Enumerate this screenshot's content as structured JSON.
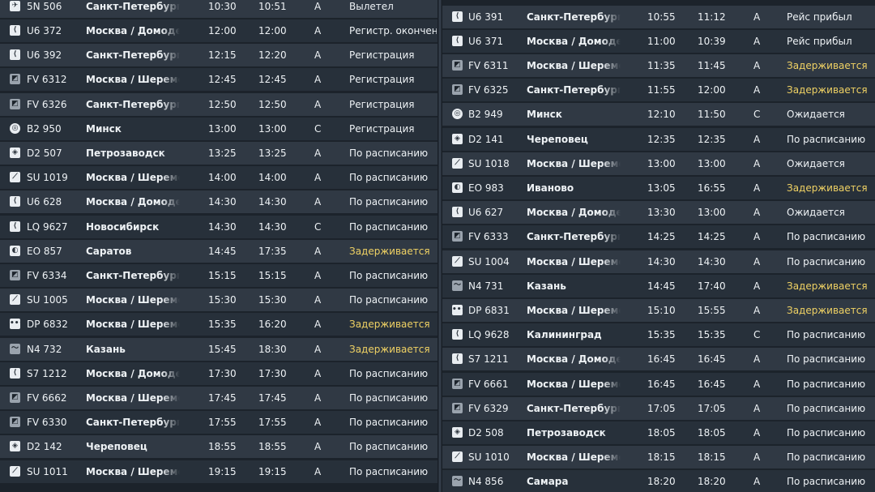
{
  "colors": {
    "background": "#1c232b",
    "row_light": "#303944",
    "row_dark": "#27303a",
    "text": "#eef2f5",
    "delayed": "#f0d264"
  },
  "left_flights": [
    {
      "logo": "plane-icon",
      "flight": "5N 506",
      "destination": "Санкт-Петербург",
      "scheduled": "10:30",
      "estimated": "10:51",
      "terminal": "A",
      "status": "Вылетел",
      "delayed": false
    },
    {
      "logo": "s7-logo-icon",
      "flight": "U6 372",
      "destination": "Москва / Домодедово",
      "scheduled": "12:00",
      "estimated": "12:00",
      "terminal": "A",
      "status": "Регистр. окончена",
      "delayed": false
    },
    {
      "logo": "s7-logo-icon",
      "flight": "U6 392",
      "destination": "Санкт-Петербург",
      "scheduled": "12:15",
      "estimated": "12:20",
      "terminal": "A",
      "status": "Регистрация",
      "delayed": false
    },
    {
      "logo": "rossiya-logo-icon",
      "flight": "FV 6312",
      "destination": "Москва / Шереметьево",
      "scheduled": "12:45",
      "estimated": "12:45",
      "terminal": "A",
      "status": "Регистрация",
      "delayed": false
    },
    {
      "logo": "rossiya-logo-icon",
      "flight": "FV 6326",
      "destination": "Санкт-Петербург",
      "scheduled": "12:50",
      "estimated": "12:50",
      "terminal": "A",
      "status": "Регистрация",
      "delayed": false
    },
    {
      "logo": "belavia-logo-icon",
      "flight": "B2 950",
      "destination": "Минск",
      "scheduled": "13:00",
      "estimated": "13:00",
      "terminal": "C",
      "status": "Регистрация",
      "delayed": false
    },
    {
      "logo": "severstal-logo-icon",
      "flight": "D2 507",
      "destination": "Петрозаводск",
      "scheduled": "13:25",
      "estimated": "13:25",
      "terminal": "A",
      "status": "По расписанию",
      "delayed": false
    },
    {
      "logo": "aeroflot-logo-icon",
      "flight": "SU 1019",
      "destination": "Москва / Шереметьево",
      "scheduled": "14:00",
      "estimated": "14:00",
      "terminal": "A",
      "status": "По расписанию",
      "delayed": false
    },
    {
      "logo": "s7-logo-icon",
      "flight": "U6 628",
      "destination": "Москва / Домодедово",
      "scheduled": "14:30",
      "estimated": "14:30",
      "terminal": "A",
      "status": "По расписанию",
      "delayed": false
    },
    {
      "logo": "s7-logo-icon",
      "flight": "LQ 9627",
      "destination": "Новосибирск",
      "scheduled": "14:30",
      "estimated": "14:30",
      "terminal": "C",
      "status": "По расписанию",
      "delayed": false
    },
    {
      "logo": "utair-logo-icon",
      "flight": "EO 857",
      "destination": "Саратов",
      "scheduled": "14:45",
      "estimated": "17:35",
      "terminal": "A",
      "status": "Задерживается",
      "delayed": true
    },
    {
      "logo": "rossiya-logo-icon",
      "flight": "FV 6334",
      "destination": "Санкт-Петербург",
      "scheduled": "15:15",
      "estimated": "15:15",
      "terminal": "A",
      "status": "По расписанию",
      "delayed": false
    },
    {
      "logo": "aeroflot-logo-icon",
      "flight": "SU 1005",
      "destination": "Москва / Шереметьево",
      "scheduled": "15:30",
      "estimated": "15:30",
      "terminal": "A",
      "status": "По расписанию",
      "delayed": false
    },
    {
      "logo": "pobeda-logo-icon",
      "flight": "DP 6832",
      "destination": "Москва / Шереметьево",
      "scheduled": "15:35",
      "estimated": "16:20",
      "terminal": "A",
      "status": "Задерживается",
      "delayed": true
    },
    {
      "logo": "nordwind-logo-icon",
      "flight": "N4 732",
      "destination": "Казань",
      "scheduled": "15:45",
      "estimated": "18:30",
      "terminal": "A",
      "status": "Задерживается",
      "delayed": true
    },
    {
      "logo": "s7-logo-icon",
      "flight": "S7 1212",
      "destination": "Москва / Домодедово",
      "scheduled": "17:30",
      "estimated": "17:30",
      "terminal": "A",
      "status": "По расписанию",
      "delayed": false
    },
    {
      "logo": "rossiya-logo-icon",
      "flight": "FV 6662",
      "destination": "Москва / Шереметьево",
      "scheduled": "17:45",
      "estimated": "17:45",
      "terminal": "A",
      "status": "По расписанию",
      "delayed": false
    },
    {
      "logo": "rossiya-logo-icon",
      "flight": "FV 6330",
      "destination": "Санкт-Петербург",
      "scheduled": "17:55",
      "estimated": "17:55",
      "terminal": "A",
      "status": "По расписанию",
      "delayed": false
    },
    {
      "logo": "severstal-logo-icon",
      "flight": "D2 142",
      "destination": "Череповец",
      "scheduled": "18:55",
      "estimated": "18:55",
      "terminal": "A",
      "status": "По расписанию",
      "delayed": false
    },
    {
      "logo": "aeroflot-logo-icon",
      "flight": "SU 1011",
      "destination": "Москва / Шереметьево",
      "scheduled": "19:15",
      "estimated": "19:15",
      "terminal": "A",
      "status": "По расписанию",
      "delayed": false
    }
  ],
  "right_flights": [
    {
      "logo": "s7-logo-icon",
      "flight": "U6 391",
      "destination": "Санкт-Петербург",
      "scheduled": "10:55",
      "estimated": "11:12",
      "terminal": "A",
      "status": "Рейс прибыл",
      "delayed": false
    },
    {
      "logo": "s7-logo-icon",
      "flight": "U6 371",
      "destination": "Москва / Домодедово",
      "scheduled": "11:00",
      "estimated": "10:39",
      "terminal": "A",
      "status": "Рейс прибыл",
      "delayed": false
    },
    {
      "logo": "rossiya-logo-icon",
      "flight": "FV 6311",
      "destination": "Москва / Шереметьево",
      "scheduled": "11:35",
      "estimated": "11:45",
      "terminal": "A",
      "status": "Задерживается",
      "delayed": true
    },
    {
      "logo": "rossiya-logo-icon",
      "flight": "FV 6325",
      "destination": "Санкт-Петербург",
      "scheduled": "11:55",
      "estimated": "12:00",
      "terminal": "A",
      "status": "Задерживается",
      "delayed": true
    },
    {
      "logo": "belavia-logo-icon",
      "flight": "B2 949",
      "destination": "Минск",
      "scheduled": "12:10",
      "estimated": "11:50",
      "terminal": "C",
      "status": "Ожидается",
      "delayed": false
    },
    {
      "logo": "severstal-logo-icon",
      "flight": "D2 141",
      "destination": "Череповец",
      "scheduled": "12:35",
      "estimated": "12:35",
      "terminal": "A",
      "status": "По расписанию",
      "delayed": false
    },
    {
      "logo": "aeroflot-logo-icon",
      "flight": "SU 1018",
      "destination": "Москва / Шереметьево",
      "scheduled": "13:00",
      "estimated": "13:00",
      "terminal": "A",
      "status": "Ожидается",
      "delayed": false
    },
    {
      "logo": "utair-logo-icon",
      "flight": "EO 983",
      "destination": "Иваново",
      "scheduled": "13:05",
      "estimated": "16:55",
      "terminal": "A",
      "status": "Задерживается",
      "delayed": true
    },
    {
      "logo": "s7-logo-icon",
      "flight": "U6 627",
      "destination": "Москва / Домодедово",
      "scheduled": "13:30",
      "estimated": "13:00",
      "terminal": "A",
      "status": "Ожидается",
      "delayed": false
    },
    {
      "logo": "rossiya-logo-icon",
      "flight": "FV 6333",
      "destination": "Санкт-Петербург",
      "scheduled": "14:25",
      "estimated": "14:25",
      "terminal": "A",
      "status": "По расписанию",
      "delayed": false
    },
    {
      "logo": "aeroflot-logo-icon",
      "flight": "SU 1004",
      "destination": "Москва / Шереметьево",
      "scheduled": "14:30",
      "estimated": "14:30",
      "terminal": "A",
      "status": "По расписанию",
      "delayed": false
    },
    {
      "logo": "nordwind-logo-icon",
      "flight": "N4 731",
      "destination": "Казань",
      "scheduled": "14:45",
      "estimated": "17:40",
      "terminal": "A",
      "status": "Задерживается",
      "delayed": true
    },
    {
      "logo": "pobeda-logo-icon",
      "flight": "DP 6831",
      "destination": "Москва / Шереметьево",
      "scheduled": "15:10",
      "estimated": "15:55",
      "terminal": "A",
      "status": "Задерживается",
      "delayed": true
    },
    {
      "logo": "s7-logo-icon",
      "flight": "LQ 9628",
      "destination": "Калининград",
      "scheduled": "15:35",
      "estimated": "15:35",
      "terminal": "C",
      "status": "По расписанию",
      "delayed": false
    },
    {
      "logo": "s7-logo-icon",
      "flight": "S7 1211",
      "destination": "Москва / Домодедово",
      "scheduled": "16:45",
      "estimated": "16:45",
      "terminal": "A",
      "status": "По расписанию",
      "delayed": false
    },
    {
      "logo": "rossiya-logo-icon",
      "flight": "FV 6661",
      "destination": "Москва / Шереметьево",
      "scheduled": "16:45",
      "estimated": "16:45",
      "terminal": "A",
      "status": "По расписанию",
      "delayed": false
    },
    {
      "logo": "rossiya-logo-icon",
      "flight": "FV 6329",
      "destination": "Санкт-Петербург",
      "scheduled": "17:05",
      "estimated": "17:05",
      "terminal": "A",
      "status": "По расписанию",
      "delayed": false
    },
    {
      "logo": "severstal-logo-icon",
      "flight": "D2 508",
      "destination": "Петрозаводск",
      "scheduled": "18:05",
      "estimated": "18:05",
      "terminal": "A",
      "status": "По расписанию",
      "delayed": false
    },
    {
      "logo": "aeroflot-logo-icon",
      "flight": "SU 1010",
      "destination": "Москва / Шереметьево",
      "scheduled": "18:15",
      "estimated": "18:15",
      "terminal": "A",
      "status": "По расписанию",
      "delayed": false
    },
    {
      "logo": "nordwind-logo-icon",
      "flight": "N4 856",
      "destination": "Самара",
      "scheduled": "18:20",
      "estimated": "18:20",
      "terminal": "A",
      "status": "По расписанию",
      "delayed": false
    }
  ]
}
